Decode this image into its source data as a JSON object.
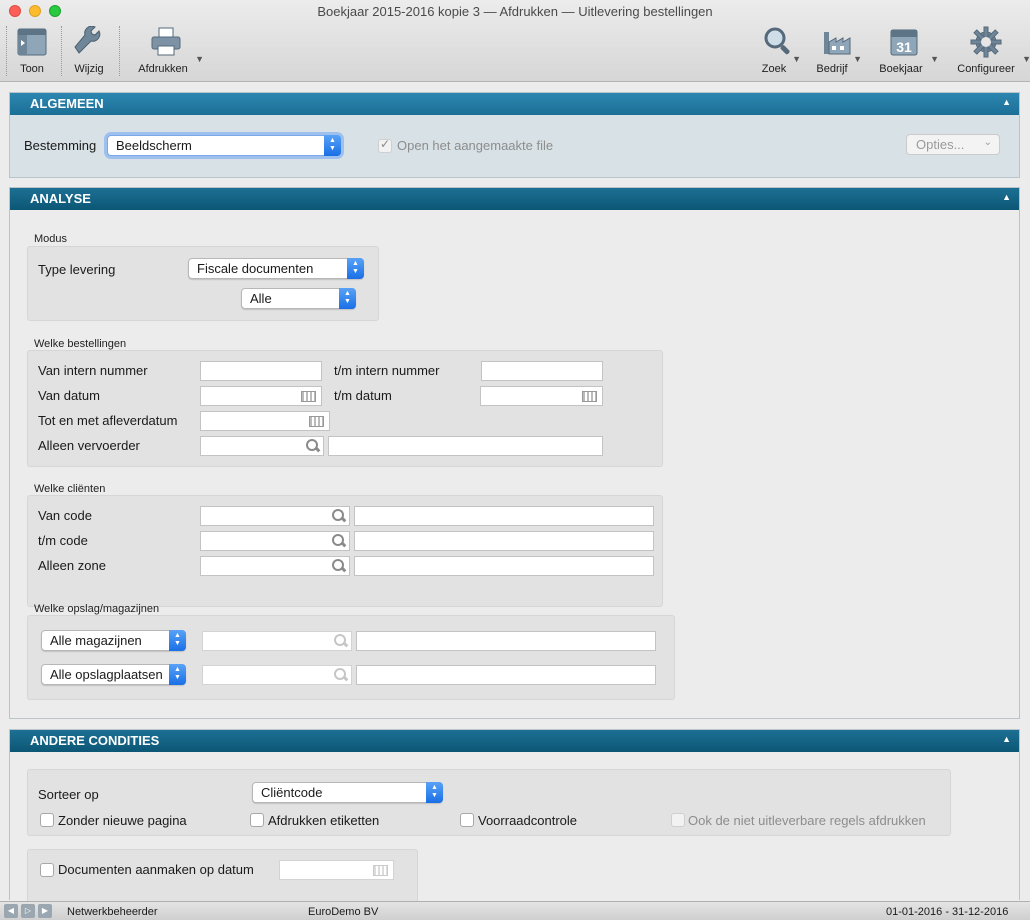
{
  "window": {
    "title": "Boekjaar 2015-2016 kopie 3 — Afdrukken — Uitlevering bestellingen"
  },
  "toolbar": {
    "toon": "Toon",
    "wijzig": "Wijzig",
    "afdrukken": "Afdrukken",
    "zoek": "Zoek",
    "bedrijf": "Bedrijf",
    "boekjaar": "Boekjaar",
    "boekjaar_icon_text": "31",
    "configureer": "Configureer"
  },
  "algemeen": {
    "header": "ALGEMEEN",
    "bestemming_label": "Bestemming",
    "bestemming_value": "Beeldscherm",
    "open_file_label": "Open het aangemaakte file",
    "open_file_checked": true,
    "opties_label": "Opties..."
  },
  "analyse": {
    "header": "ANALYSE",
    "modus": {
      "title": "Modus",
      "type_levering_label": "Type levering",
      "type_levering_value": "Fiscale documenten",
      "sub_value": "Alle"
    },
    "bestellingen": {
      "title": "Welke bestellingen",
      "van_intern_label": "Van intern nummer",
      "tm_intern_label": "t/m intern nummer",
      "van_datum_label": "Van datum",
      "tm_datum_label": "t/m datum",
      "tot_aflever_label": "Tot en met afleverdatum",
      "alleen_vervoerder_label": "Alleen vervoerder"
    },
    "clienten": {
      "title": "Welke cliënten",
      "van_code_label": "Van code",
      "tm_code_label": "t/m code",
      "alleen_zone_label": "Alleen zone"
    },
    "opslag": {
      "title": "Welke opslag/magazijnen",
      "magazijnen_value": "Alle magazijnen",
      "opslagplaatsen_value": "Alle opslagplaatsen"
    }
  },
  "andere": {
    "header": "ANDERE CONDITIES",
    "sorteer_label": "Sorteer op",
    "sorteer_value": "Cliëntcode",
    "zonder_pagina": "Zonder nieuwe pagina",
    "afdrukken_etiketten": "Afdrukken etiketten",
    "voorraadcontrole": "Voorraadcontrole",
    "ook_niet": "Ook de niet uitleverbare regels afdrukken",
    "documenten_datum": "Documenten aanmaken op datum"
  },
  "status": {
    "user": "Netwerkbeheerder",
    "company": "EuroDemo BV",
    "period": "01-01-2016 - 31-12-2016"
  }
}
